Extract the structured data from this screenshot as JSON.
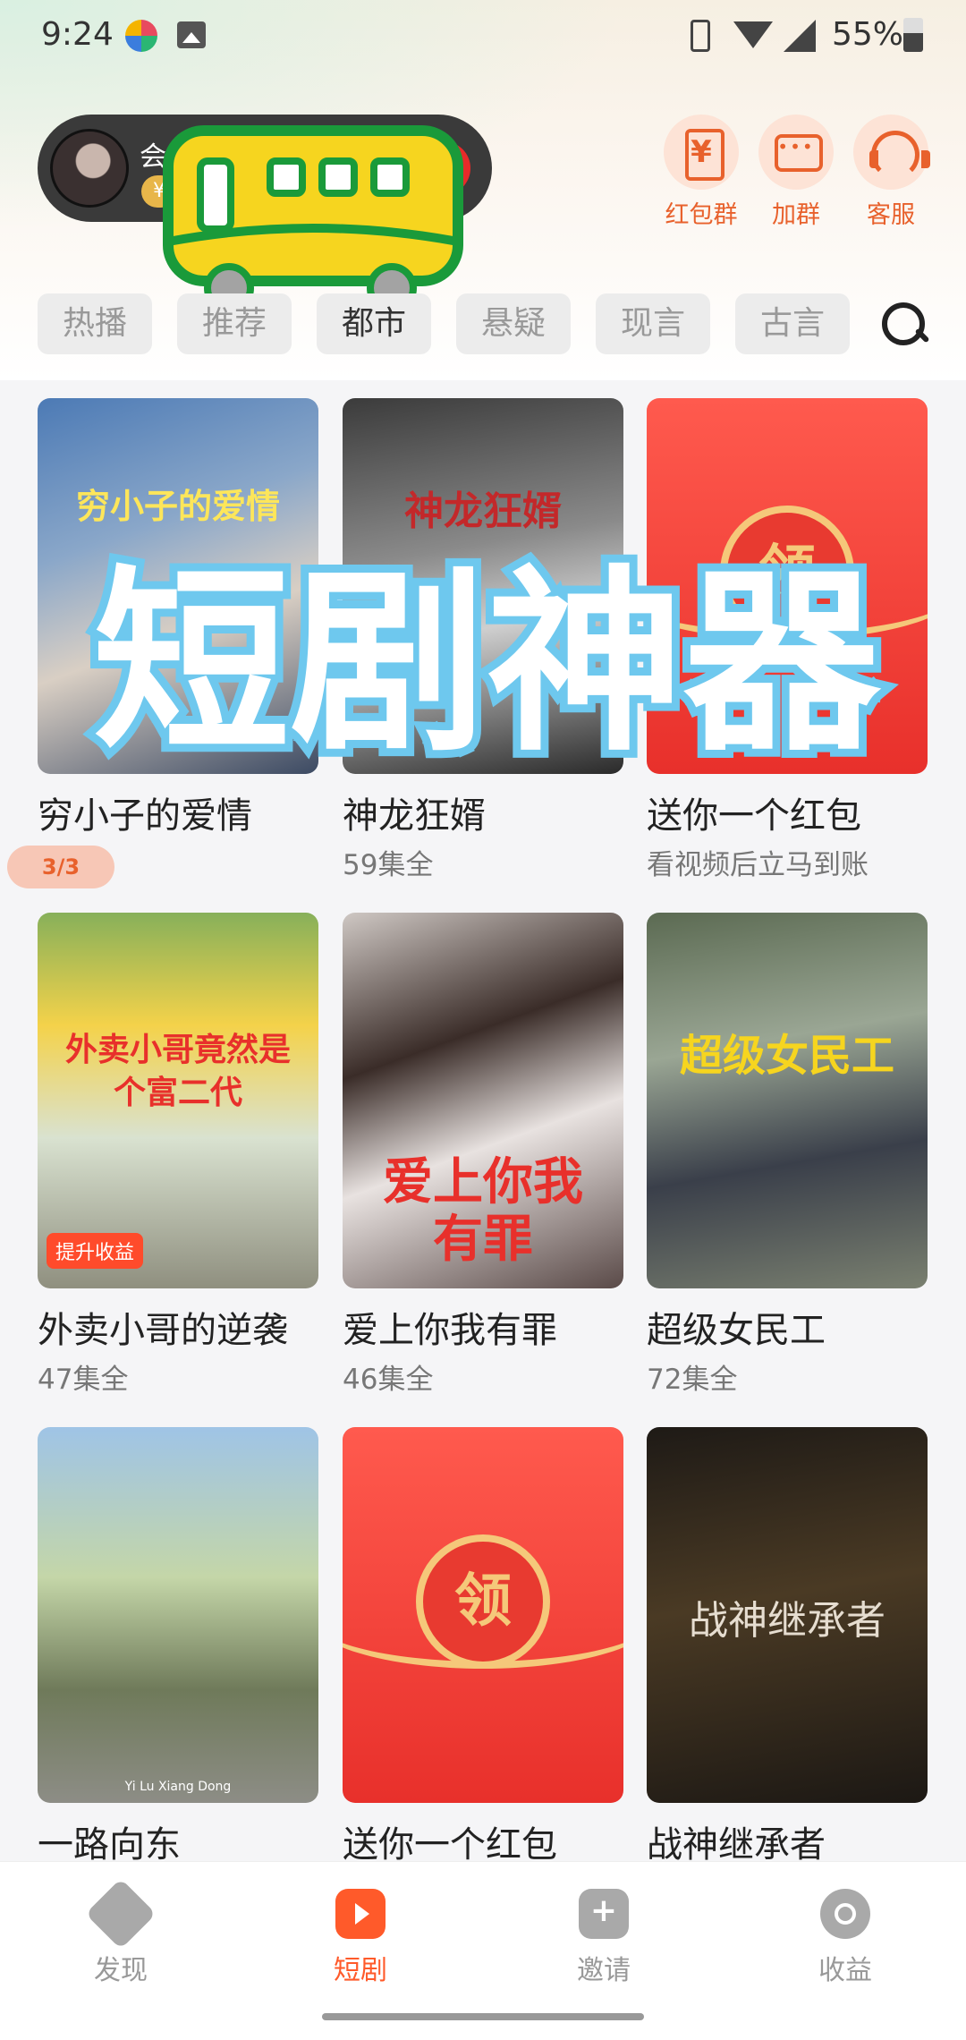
{
  "status_bar": {
    "time": "9:24",
    "battery": "55%"
  },
  "user": {
    "name": "会员",
    "coin_badge": "¥"
  },
  "top_actions": [
    {
      "label": "红包群",
      "icon": "hongbao-group-icon"
    },
    {
      "label": "加群",
      "icon": "chat-group-icon"
    },
    {
      "label": "客服",
      "icon": "headset-icon"
    }
  ],
  "tabs": [
    "热播",
    "推荐",
    "都市",
    "悬疑",
    "现言",
    "古言"
  ],
  "active_tab": "都市",
  "overlay_title": "短剧神器",
  "dramas": [
    {
      "title": "穷小子的爱情",
      "subtitle": "",
      "poster_text": "穷小子的爱情"
    },
    {
      "title": "神龙狂婿",
      "subtitle": "59集全",
      "poster_text": "神龙狂婿"
    },
    {
      "title": "送你一个红包",
      "subtitle": "看视频后立马到账",
      "poster_text": "领"
    },
    {
      "title": "外卖小哥的逆袭",
      "subtitle": "47集全",
      "poster_text": "外卖小哥竟然是个富二代"
    },
    {
      "title": "爱上你我有罪",
      "subtitle": "46集全",
      "poster_text": "爱上你我有罪"
    },
    {
      "title": "超级女民工",
      "subtitle": "72集全",
      "poster_text": "超级女民工"
    },
    {
      "title": "一路向东",
      "subtitle": "",
      "poster_text": "Yi Lu Xiang Dong"
    },
    {
      "title": "送你一个红包",
      "subtitle": "",
      "poster_text": "领"
    },
    {
      "title": "战神继承者",
      "subtitle": "",
      "poster_text": "战神继承者"
    }
  ],
  "badges": {
    "boost": "提升收益",
    "episode": "3/3"
  },
  "bottom_nav": [
    {
      "label": "发现",
      "icon": "discover-icon"
    },
    {
      "label": "短剧",
      "icon": "drama-play-icon"
    },
    {
      "label": "邀请",
      "icon": "invite-icon"
    },
    {
      "label": "收益",
      "icon": "earnings-icon"
    }
  ],
  "active_nav": "短剧",
  "colors": {
    "accent": "#e8612c",
    "nav_active": "#ff5a2a",
    "overlay_fill": "#ffffff",
    "overlay_stroke": "#6ec8ee"
  }
}
